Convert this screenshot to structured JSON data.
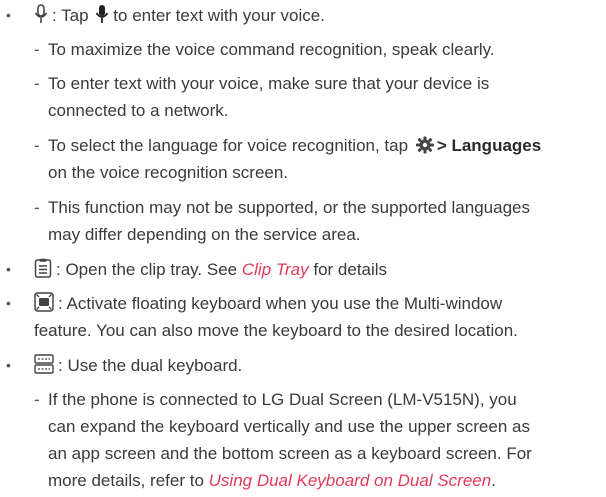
{
  "items": [
    {
      "icon": "microphone-icon",
      "text_prefix": ": Tap",
      "text_suffix": "to enter text with your voice.",
      "subitems": [
        {
          "lines": [
            "To maximize the voice command recognition, speak clearly."
          ]
        },
        {
          "lines": [
            "To enter text with your voice, make sure that your device is",
            "connected to a network."
          ]
        },
        {
          "line1_prefix": "To select the language for voice recognition, tap",
          "line1_bold": "> Languages",
          "line2": "on the voice recognition screen."
        },
        {
          "lines": [
            "This function may not be supported, or the supported languages",
            "may differ depending on the service area."
          ]
        }
      ]
    },
    {
      "icon": "clipboard-icon",
      "text_prefix": ": Open the clip tray. See",
      "link": "Clip Tray",
      "text_suffix": "for details"
    },
    {
      "icon": "floating-keyboard-icon",
      "lines": [
        ": Activate floating keyboard when you use the Multi-window",
        "feature. You can also move the keyboard to the desired location."
      ]
    },
    {
      "icon": "dual-keyboard-icon",
      "text": ": Use the dual keyboard.",
      "subitems": [
        {
          "lines": [
            "If the phone is connected to LG Dual Screen (LM-V515N), you",
            "can expand the keyboard vertically and use the upper screen as",
            "an app screen and the bottom screen as a keyboard screen. For"
          ],
          "last_prefix": "more details, refer to",
          "last_link": "Using Dual Keyboard on Dual Screen",
          "last_suffix": "."
        }
      ]
    }
  ],
  "colors": {
    "text": "#3a3a3a",
    "link": "#e2395a"
  }
}
